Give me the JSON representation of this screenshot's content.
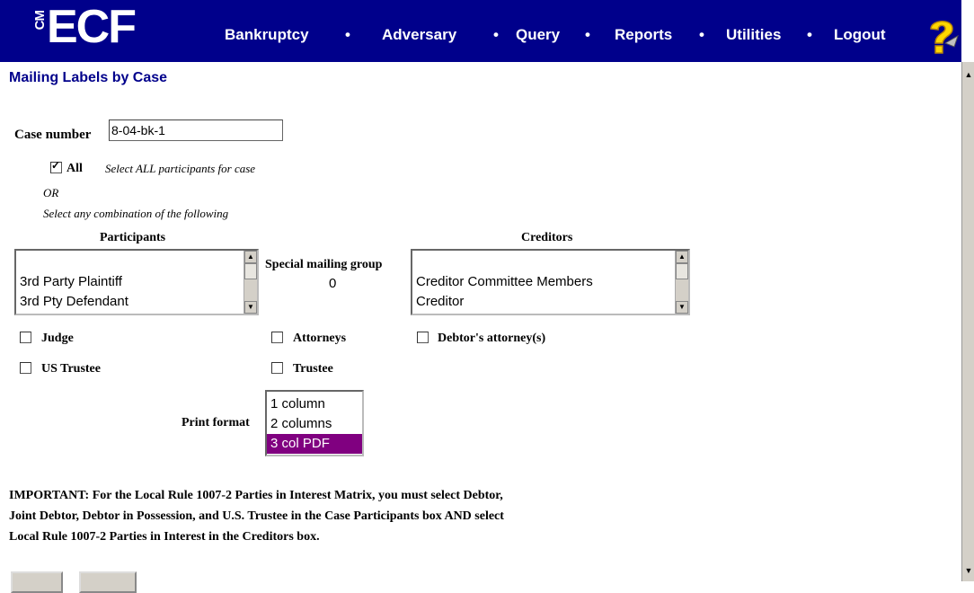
{
  "header": {
    "logo_cm": "CM",
    "logo_ecf": "ECF",
    "nav": [
      "Bankruptcy",
      "Adversary",
      "Query",
      "Reports",
      "Utilities",
      "Logout"
    ],
    "separator": "•",
    "help_icon": "help-question-icon"
  },
  "page": {
    "title": "Mailing Labels by Case",
    "case_number_label": "Case number",
    "case_number_value": "8-04-bk-1",
    "all_label": "All",
    "all_checked": true,
    "all_desc": "Select ALL participants for case",
    "or_text": "OR",
    "combo_text": "Select any combination of the following",
    "participants_header": "Participants",
    "participants_options": [
      "3rd Party Plaintiff",
      "3rd Pty Defendant"
    ],
    "special_group_label": "Special mailing group",
    "special_group_value": "0",
    "creditors_header": "Creditors",
    "creditors_options": [
      "Creditor Committee Members",
      "Creditor"
    ],
    "checkboxes": {
      "judge": "Judge",
      "attorneys": "Attorneys",
      "debtor_attorney": "Debtor's attorney(s)",
      "us_trustee": "US Trustee",
      "trustee": "Trustee"
    },
    "print_format_label": "Print format",
    "print_format_options": [
      "1 column",
      "2 columns",
      "3 col PDF"
    ],
    "print_format_selected": "3 col PDF",
    "important_lines": [
      "IMPORTANT: For the Local Rule 1007-2 Parties in Interest Matrix, you must select Debtor,",
      "Joint Debtor, Debtor in Possession, and U.S. Trustee in the Case Participants box AND select",
      "Local Rule 1007-2 Parties in Interest in the Creditors box."
    ]
  },
  "colors": {
    "navbar": "#00008b",
    "title": "#00008b",
    "selected": "#800080"
  }
}
